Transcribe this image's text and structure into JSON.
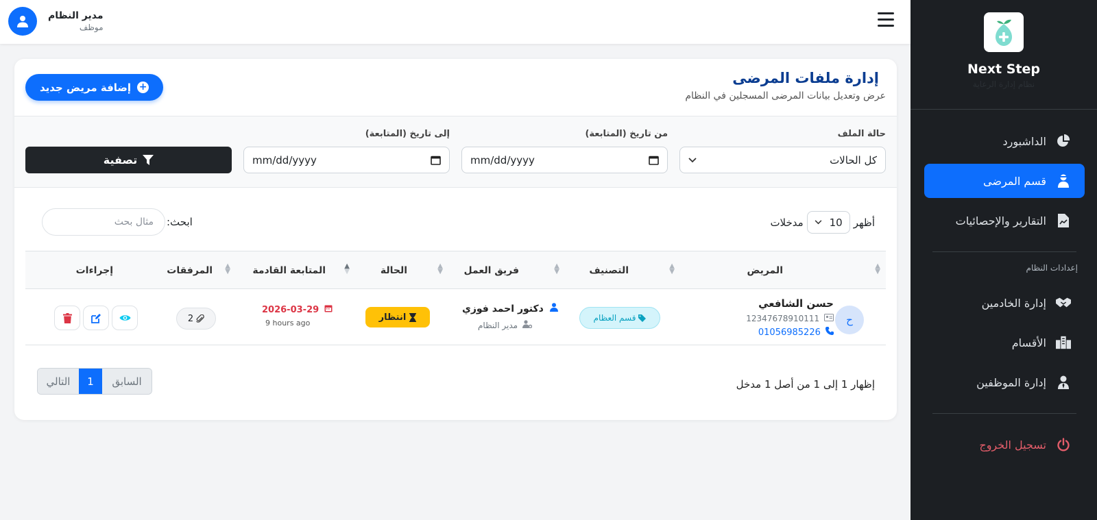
{
  "brand": {
    "name": "Next Step",
    "subtitle": "نظام إدارة الرعاية"
  },
  "sidebar": {
    "items": [
      {
        "label": "الداشبورد",
        "icon": "chart-pie-icon"
      },
      {
        "label": "قسم المرضى",
        "icon": "user-injured-icon",
        "active": true
      },
      {
        "label": "التقارير والإحصائيات",
        "icon": "file-report-icon"
      }
    ],
    "section_label": "إعدادات النظام",
    "settings_items": [
      {
        "label": "إدارة الخادمين",
        "icon": "handshake-icon"
      },
      {
        "label": "الأقسام",
        "icon": "building-icon"
      },
      {
        "label": "إدارة الموظفين",
        "icon": "user-tie-icon"
      }
    ],
    "logout_label": "تسجيل الخروج"
  },
  "topbar": {
    "user_name": "مدير النظام",
    "user_role": "موظف"
  },
  "page": {
    "title": "إدارة ملفات المرضى",
    "subtitle": "عرض وتعديل بيانات المرضى المسجلين في النظام",
    "add_button": "إضافة مريض جديد"
  },
  "filters": {
    "status_label": "حالة الملف",
    "status_value": "كل الحالات",
    "from_label": "من تاريخ (المتابعة)",
    "from_placeholder": "mm/dd/yyyy",
    "to_label": "إلى تاريخ (المتابعة)",
    "to_placeholder": "mm/dd/yyyy",
    "filter_button": "تصفية"
  },
  "table_controls": {
    "show_label": "أظهر",
    "page_length": "10",
    "entries_label": "مدخلات",
    "search_label": "ابحث:",
    "search_placeholder": "مثال بحث"
  },
  "table": {
    "headers": [
      "المريض",
      "التصنيف",
      "فريق العمل",
      "الحالة",
      "المتابعة القادمة",
      "المرفقات",
      "إجراءات"
    ],
    "rows": [
      {
        "initial": "ح",
        "name": "حسن الشافعي",
        "national_id": "12347678910111",
        "phone": "01056985226",
        "category": "قسم العظام",
        "team_member": "دكتور احمد فوزي",
        "team_role": "مدير النظام",
        "status": "انتظار",
        "next_followup": "2026-03-29",
        "next_followup_ago": "9 hours ago",
        "attachments": "2"
      }
    ]
  },
  "footer": {
    "info": "إظهار 1 إلى 1 من أصل 1 مدخل",
    "prev": "السابق",
    "page": "1",
    "next": "التالي"
  },
  "colors": {
    "primary": "#0d6efd",
    "sidebar_bg": "#1c1f23",
    "warning": "#ffc107",
    "danger": "#dc3545",
    "info": "#0dcaf0"
  }
}
